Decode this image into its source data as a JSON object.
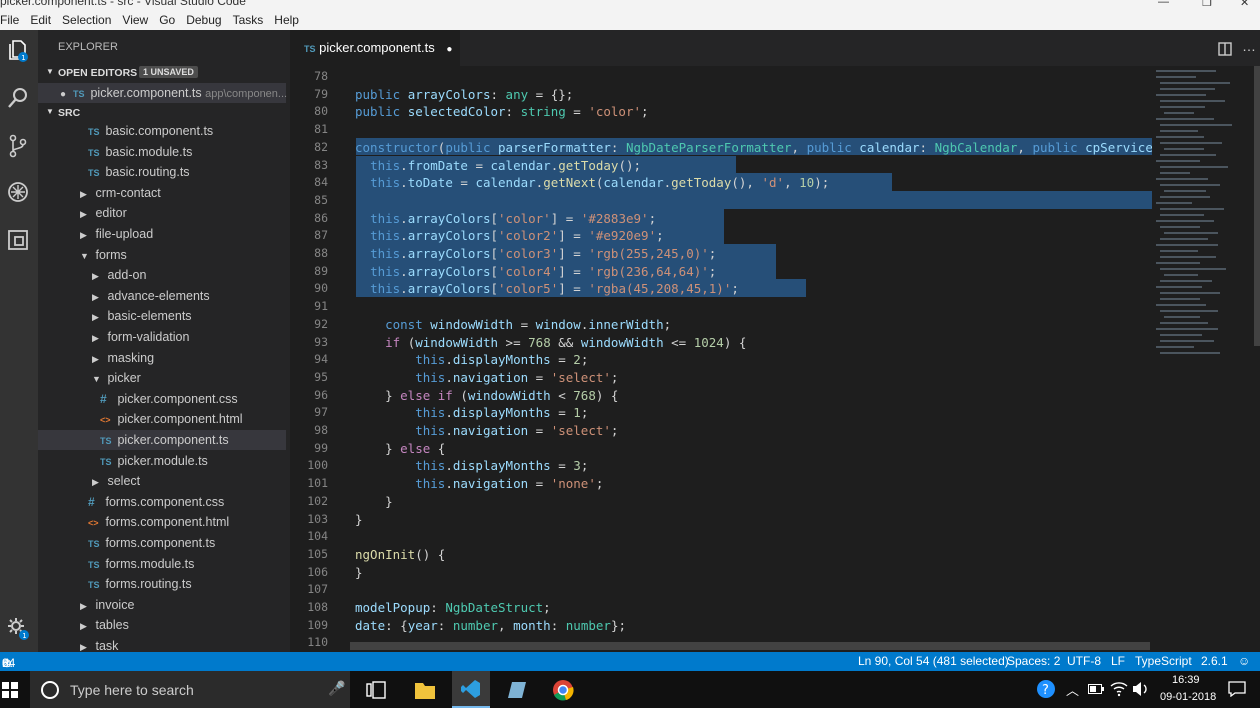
{
  "window": {
    "title": "picker.component.ts - src - Visual Studio Code"
  },
  "menu": [
    "File",
    "Edit",
    "Selection",
    "View",
    "Go",
    "Debug",
    "Tasks",
    "Help"
  ],
  "sidebar": {
    "header": "EXPLORER",
    "open_editors": {
      "title": "OPEN EDITORS",
      "badge": "1 UNSAVED",
      "item": {
        "icon": "TS",
        "name": "picker.component.ts",
        "path": "app\\componen..."
      }
    },
    "src_title": "SRC",
    "tree": [
      {
        "icon": "TS",
        "name": "basic.component.ts"
      },
      {
        "icon": "TS",
        "name": "basic.module.ts"
      },
      {
        "icon": "TS",
        "name": "basic.routing.ts"
      },
      {
        "icon": "folder",
        "name": "crm-contact"
      },
      {
        "icon": "folder",
        "name": "editor"
      },
      {
        "icon": "folder",
        "name": "file-upload"
      },
      {
        "icon": "folder-open",
        "name": "forms"
      },
      {
        "icon": "folder",
        "name": "add-on"
      },
      {
        "icon": "folder",
        "name": "advance-elements"
      },
      {
        "icon": "folder",
        "name": "basic-elements"
      },
      {
        "icon": "folder",
        "name": "form-validation"
      },
      {
        "icon": "folder",
        "name": "masking"
      },
      {
        "icon": "folder-open",
        "name": "picker"
      },
      {
        "icon": "#",
        "name": "picker.component.css"
      },
      {
        "icon": "<>",
        "name": "picker.component.html"
      },
      {
        "icon": "TS",
        "name": "picker.component.ts"
      },
      {
        "icon": "TS",
        "name": "picker.module.ts"
      },
      {
        "icon": "folder",
        "name": "select"
      },
      {
        "icon": "#",
        "name": "forms.component.css"
      },
      {
        "icon": "<>",
        "name": "forms.component.html"
      },
      {
        "icon": "TS",
        "name": "forms.component.ts"
      },
      {
        "icon": "TS",
        "name": "forms.module.ts"
      },
      {
        "icon": "TS",
        "name": "forms.routing.ts"
      },
      {
        "icon": "folder",
        "name": "invoice"
      },
      {
        "icon": "folder",
        "name": "tables"
      },
      {
        "icon": "folder",
        "name": "task"
      }
    ]
  },
  "tab": {
    "icon": "TS",
    "label": "picker.component.ts"
  },
  "code": {
    "line_numbers": [
      "78",
      "79",
      "80",
      "81",
      "82",
      "83",
      "84",
      "85",
      "86",
      "87",
      "88",
      "89",
      "90",
      "91",
      "92",
      "93",
      "94",
      "95",
      "96",
      "97",
      "98",
      "99",
      "100",
      "101",
      "102",
      "103",
      "104",
      "105",
      "106",
      "107",
      "108",
      "109",
      "110"
    ]
  },
  "status": {
    "errors": "84",
    "warnings": "0",
    "position": "Ln 90, Col 54 (481 selected)",
    "spaces": "Spaces: 2",
    "encoding": "UTF-8",
    "eol": "LF",
    "language": "TypeScript",
    "version": "2.6.1"
  },
  "taskbar": {
    "search_placeholder": "Type here to search",
    "time": "16:39",
    "date": "09-01-2018"
  }
}
